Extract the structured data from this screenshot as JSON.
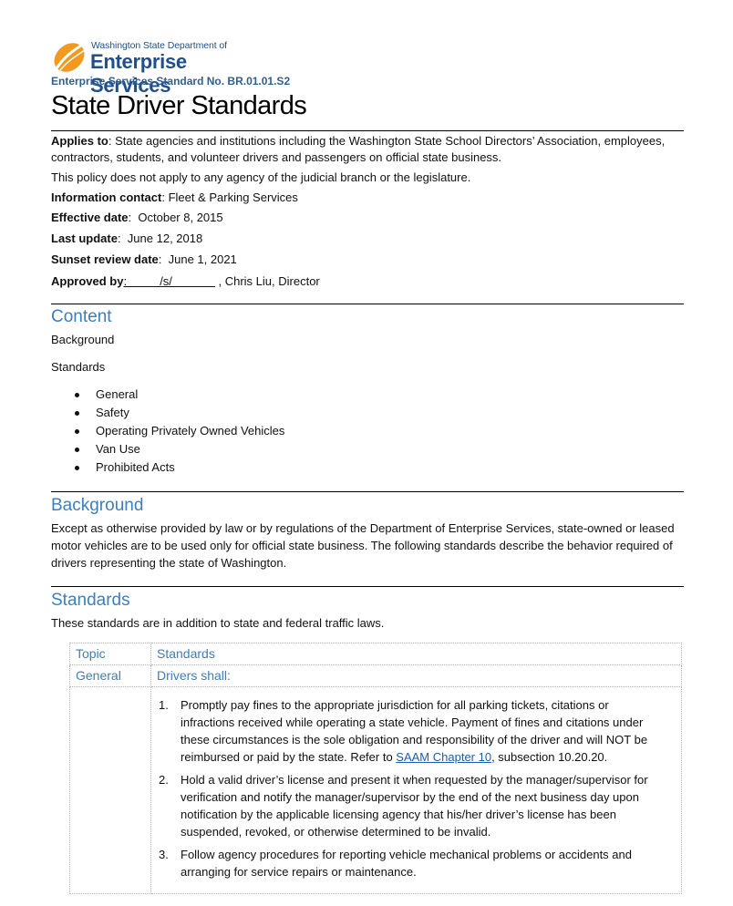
{
  "header": {
    "logo": {
      "icon": "orange-swoosh-logo-icon",
      "line1": "Washington State Department of",
      "line2": "Enterprise Services"
    },
    "standard_number": "Enterprise Services Standard No. BR.01.01.S2",
    "title": "State Driver Standards"
  },
  "meta": {
    "applies_to_label": "Applies to",
    "applies_to_value": ": State agencies and institutions including the Washington State School Directors’ Association, employees, contractors, students, and volunteer drivers and passengers on official state business.",
    "exclusion": "This policy does not apply to any agency of the judicial branch or the legislature.",
    "contact_label": "Information contact",
    "contact_value": ": Fleet & Parking Services",
    "effective_label": "Effective date",
    "effective_value": ":  October 8, 2015",
    "last_update_label": "Last update",
    "last_update_value": ":  June 12, 2018",
    "sunset_label": "Sunset review date",
    "sunset_value": ":  June 1, 2021",
    "approved_label": "Approved by",
    "approved_signature": ":          /s/             ",
    "approved_value": " , Chris Liu, Director"
  },
  "content": {
    "heading": "Content",
    "items": [
      "Background",
      "Standards"
    ],
    "sub_items": [
      "General",
      "Safety",
      "Operating Privately Owned Vehicles",
      "Van Use",
      "Prohibited Acts"
    ]
  },
  "background": {
    "heading": "Background",
    "text": "Except as otherwise provided by law or by regulations of the Department of Enterprise Services, state-owned or leased motor vehicles are to be used only for official state business. The following standards describe the behavior required of drivers representing the state of Washington."
  },
  "standards": {
    "heading": "Standards",
    "intro": "These standards are in addition to state and federal traffic laws.",
    "table": {
      "headers": [
        "Topic",
        "Standards"
      ],
      "rows": [
        {
          "topic": "General",
          "lead": "Drivers shall:",
          "items": [
            {
              "num": "1.",
              "text_before": "Promptly pay fines to the appropriate jurisdiction for all parking tickets, citations or infractions received while operating a state vehicle. Payment of fines and citations under these circumstances is the sole obligation and responsibility of the driver and will NOT be reimbursed or paid by the state. Refer to ",
              "link": "SAAM Chapter 10",
              "text_after": ", subsection 10.20.20."
            },
            {
              "num": "2.",
              "text_before": "Hold a valid driver’s license and present it when requested by the manager/supervisor for verification and notify the manager/supervisor by the end of the next business day upon notification by the applicable licensing agency that his/her driver’s license has been suspended, revoked, or otherwise determined to be invalid."
            },
            {
              "num": "3.",
              "text_before": "Follow agency procedures for reporting vehicle mechanical problems or accidents and arranging for service repairs or maintenance."
            }
          ]
        }
      ]
    }
  },
  "colors": {
    "heading_blue": "#3b7fc4",
    "brand_navy": "#1f4f8f",
    "brand_orange": "#f39a1e",
    "link_blue": "#1a5fb4"
  }
}
